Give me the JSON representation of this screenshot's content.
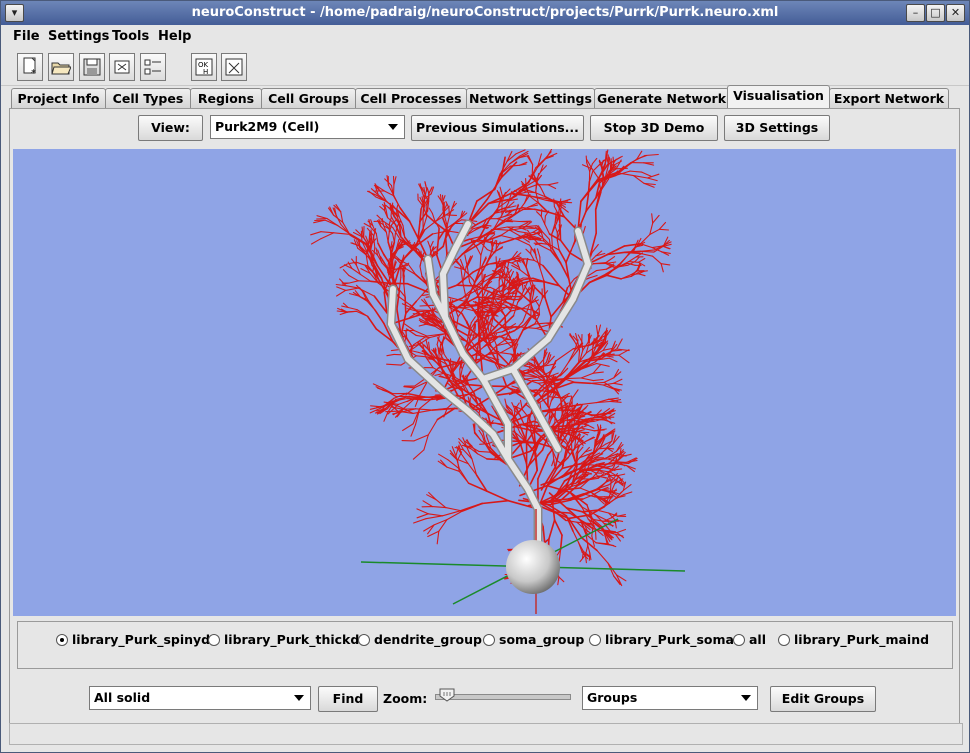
{
  "window": {
    "title": "neuroConstruct - /home/padraig/neuroConstruct/projects/Purrk/Purrk.neuro.xml"
  },
  "menu": [
    "File",
    "Settings",
    "Tools",
    "Help"
  ],
  "toolbar": {
    "icons": [
      "new-project-icon",
      "open-project-icon",
      "save-project-icon",
      "close-project-icon",
      "preferences-icon",
      "check-help-icon",
      "exit-icon"
    ]
  },
  "tabs": [
    "Project Info",
    "Cell Types",
    "Regions",
    "Cell Groups",
    "Cell Processes",
    "Network Settings",
    "Generate Network",
    "Visualisation",
    "Export Network"
  ],
  "active_tab": "Visualisation",
  "vis_toolbar": {
    "view_label": "View:",
    "view_select": "Purk2M9 (Cell)",
    "prev_sims": "Previous Simulations...",
    "stop_demo": "Stop 3D Demo",
    "settings_3d": "3D Settings"
  },
  "groups": [
    {
      "label": "library_Purk_spinyd",
      "selected": true
    },
    {
      "label": "library_Purk_thickd",
      "selected": false
    },
    {
      "label": "dendrite_group",
      "selected": false
    },
    {
      "label": "soma_group",
      "selected": false
    },
    {
      "label": "library_Purk_soma",
      "selected": false
    },
    {
      "label": "all",
      "selected": false
    },
    {
      "label": "library_Purk_maind",
      "selected": false
    }
  ],
  "bottom": {
    "display_select": "All solid",
    "find": "Find",
    "zoom_label": "Zoom:",
    "zoom_level": 0.1,
    "groups_select": "Groups",
    "edit_groups": "Edit Groups"
  },
  "colors": {
    "canvas_bg": "#8fa4e6",
    "dendrite": "#d81818",
    "trunk": "#e4e4e4"
  }
}
